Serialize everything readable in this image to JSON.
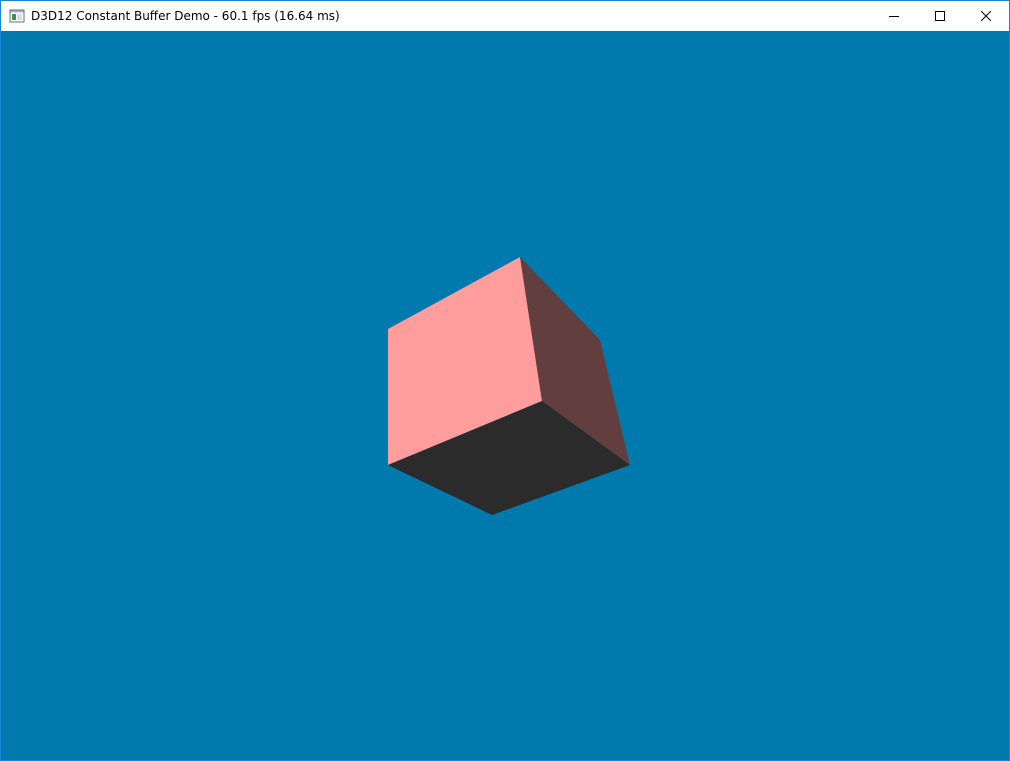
{
  "window": {
    "title": "D3D12 Constant Buffer Demo - 60.1 fps (16.64 ms)",
    "app_icon": "window-app-icon",
    "controls": {
      "minimize": "minimize-icon",
      "maximize": "maximize-icon",
      "close": "close-icon"
    }
  },
  "viewport": {
    "clear_color": "#0079ad",
    "cube": {
      "front_face_color": "#ff9c9c",
      "side_face_color": "#633e3e",
      "bottom_face_color": "#2b2b2b"
    }
  }
}
